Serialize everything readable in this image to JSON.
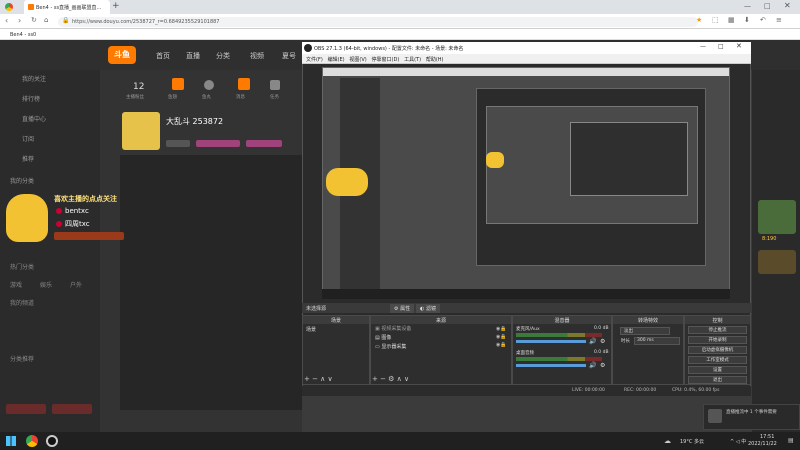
{
  "browser": {
    "tab_title": "Ben4 - ss直播_画画联盟直...",
    "url": "https://www.douyu.com/2538727_r=0.6849235529101887",
    "bookmark": "Ben4 - ss0"
  },
  "douyu": {
    "logo": "斗鱼",
    "nav": [
      "首页",
      "直播",
      "分类",
      "视频",
      "夏号"
    ],
    "stats": [
      {
        "value": "12",
        "label": "主播粉丝"
      },
      {
        "value": "",
        "label": "鱼翅"
      },
      {
        "value": "",
        "label": "鱼丸"
      },
      {
        "value": "",
        "label": "消息"
      },
      {
        "value": "",
        "label": "任务"
      },
      {
        "value": "",
        "label": "开播"
      }
    ],
    "streamer": "大乱斗 253872",
    "sidebar": [
      "我的关注",
      "排行榜",
      "直播中心",
      "订阅",
      "推荐",
      "我的分类",
      "热门分类",
      "游戏",
      "娱乐",
      "户外",
      "我的频道",
      "分类推荐"
    ],
    "overlay": {
      "headline": "喜欢主播的点点关注",
      "users": [
        "bentxc",
        "四周txc"
      ]
    },
    "right_badge": "8:190",
    "right_date": "2022/11/22"
  },
  "obs": {
    "title": "OBS 27.1.3 (64-bit, windows) - 配置文件: 未命名 - 场景: 未命名",
    "menu": [
      "文件(F)",
      "编辑(E)",
      "视图(V)",
      "停靠窗口(D)",
      "工具(T)",
      "帮助(H)"
    ],
    "toolbar": [
      "未选择源",
      "属性",
      "滤镜"
    ],
    "docks": {
      "scenes": "场景",
      "sources": "来源",
      "mixer": "混音器",
      "transitions": "转场特效",
      "controls": "控制"
    },
    "scene_items": [
      "场景"
    ],
    "source_items": [
      "视频采集设备",
      "图像",
      "显示器采集"
    ],
    "mixer": [
      {
        "name": "麦克风/Aux",
        "level": "0.0 dB"
      },
      {
        "name": "桌面音频",
        "level": "0.0 dB"
      }
    ],
    "transition": {
      "type": "淡出",
      "duration_label": "时长",
      "duration": "300 ms"
    },
    "controls": [
      "停止推流",
      "开始录制",
      "启动虚拟摄像机",
      "工作室模式",
      "设置",
      "退出"
    ],
    "status": {
      "live": "LIVE: 00:00:00",
      "rec": "REC: 00:00:00",
      "cpu": "CPU: 0.4%, 60.00 fps"
    }
  },
  "taskbar": {
    "weather": "19°C 多云",
    "time": "17:51",
    "date": "2022/11/22",
    "lang": "中"
  },
  "toast": {
    "text": "直播推流中 1 个事件需要"
  },
  "colors": {
    "douyu_orange": "#ff7a00",
    "obs_bg": "#2b2b2b",
    "accent_red": "#cc0033"
  }
}
